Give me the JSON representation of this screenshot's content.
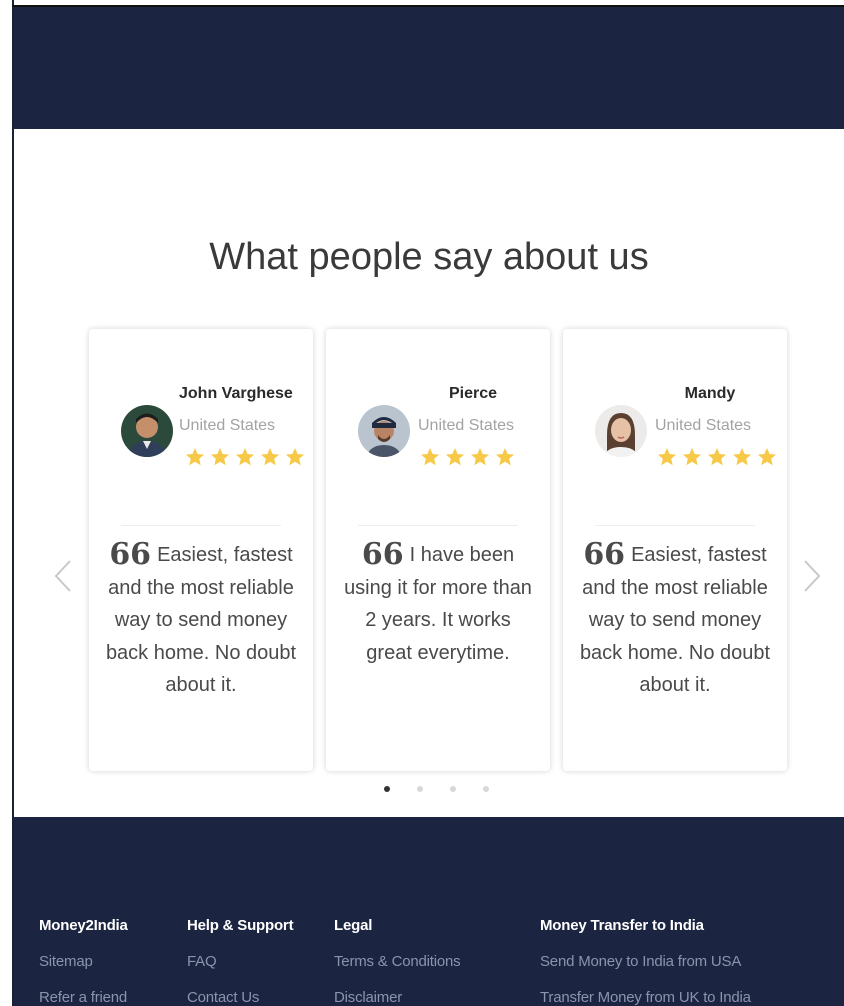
{
  "section": {
    "title": "What people say about us"
  },
  "testimonials": [
    {
      "name": "John Varghese",
      "country": "United States",
      "rating": 5,
      "quote_mark": "66",
      "quote": "Easiest, fastest and the most reliable way to send money back home. No doubt about it."
    },
    {
      "name": "Pierce",
      "country": "United States",
      "rating": 4,
      "quote_mark": "66",
      "quote": "I have been using it for more than 2 years. It works great everytime."
    },
    {
      "name": "Mandy",
      "country": "United States",
      "rating": 5,
      "quote_mark": "66",
      "quote": "Easiest, fastest and the most reliable way to send money back home. No doubt about it."
    }
  ],
  "carousel": {
    "page_count": 4,
    "active_page": 1
  },
  "icons": {
    "prev": "chevron-left-icon",
    "next": "chevron-right-icon",
    "star": "star-icon"
  },
  "colors": {
    "header_bg": "#1b2440",
    "footer_bg": "#1b2440",
    "star": "#f7c948",
    "footer_link": "#8b94ad"
  },
  "footer": {
    "columns": [
      {
        "heading": "Money2India",
        "links": [
          "Sitemap",
          "Refer a friend"
        ]
      },
      {
        "heading": "Help & Support",
        "links": [
          "FAQ",
          "Contact Us"
        ]
      },
      {
        "heading": "Legal",
        "links": [
          "Terms & Conditions",
          "Disclaimer"
        ]
      },
      {
        "heading": "Money Transfer to India",
        "links": [
          "Send Money to India from USA",
          "Transfer Money from UK to India"
        ]
      }
    ]
  }
}
